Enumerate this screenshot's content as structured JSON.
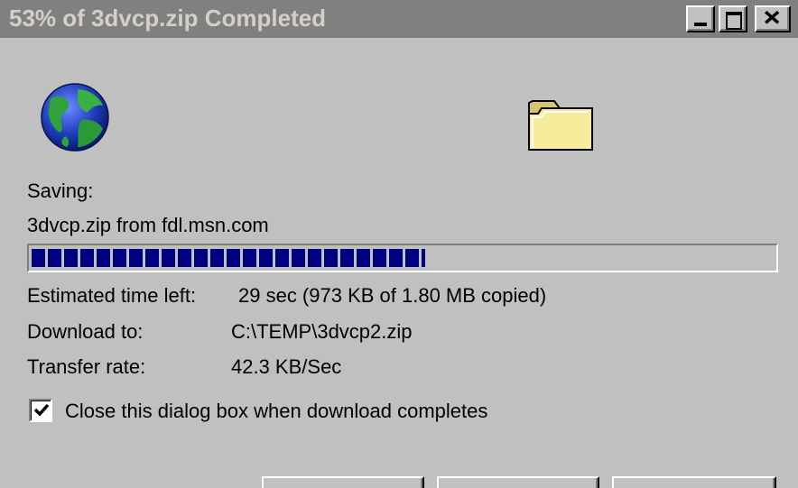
{
  "window": {
    "title": "53% of 3dvcp.zip Completed"
  },
  "icons": {
    "globe": "globe-icon",
    "folder": "folder-icon"
  },
  "status": {
    "saving_label": "Saving:",
    "source": "3dvcp.zip from fdl.msn.com",
    "progress_percent": 53
  },
  "details": {
    "time_left_label": "Estimated time left:",
    "time_left_value": "29 sec (973 KB of 1.80 MB copied)",
    "download_to_label": "Download to:",
    "download_to_value": "C:\\TEMP\\3dvcp2.zip",
    "transfer_rate_label": "Transfer rate:",
    "transfer_rate_value": "42.3 KB/Sec"
  },
  "options": {
    "close_on_complete_label": "Close this dialog box when download completes",
    "close_on_complete_checked": true
  },
  "colors": {
    "face": "#c0c0c0",
    "titlebar_inactive": "#808080",
    "progress_fill": "#000080"
  }
}
